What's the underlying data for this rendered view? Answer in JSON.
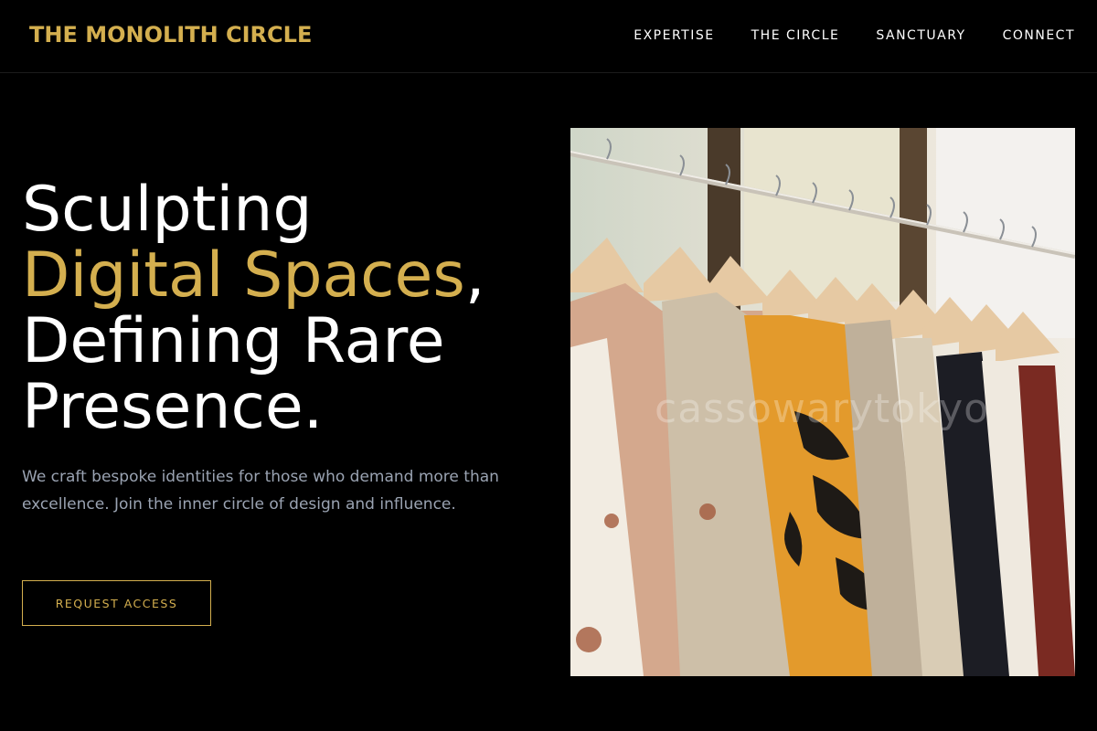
{
  "header": {
    "brand": "THE MONOLITH CIRCLE",
    "nav": [
      "EXPERTISE",
      "THE CIRCLE",
      "SANCTUARY",
      "CONNECT"
    ]
  },
  "hero": {
    "headline": {
      "line1": "Sculpting",
      "line2_highlight": "Digital Spaces",
      "line2_suffix": ",",
      "line3": "Defining Rare",
      "line4": "Presence."
    },
    "description": "We craft bespoke identities for those who demand more than excellence. Join the inner circle of design and influence.",
    "cta_label": "REQUEST ACCESS",
    "image": {
      "subject": "clothing rack with shirts on wooden hangers",
      "watermark": "cassowarytokyo"
    }
  },
  "colors": {
    "background": "#000000",
    "accent_gold": "#d4af4f",
    "text_primary": "#ffffff",
    "text_muted": "#9aa3b2"
  }
}
